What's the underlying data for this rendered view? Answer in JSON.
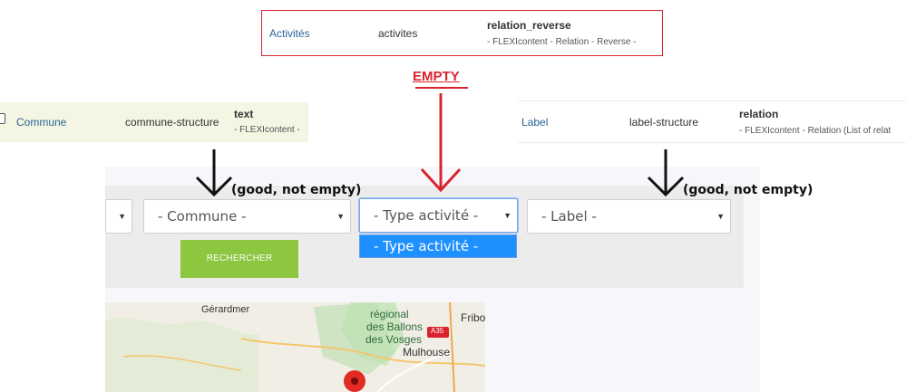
{
  "top_row": {
    "link": "Activités",
    "field_name": "activites",
    "type": "relation_reverse",
    "description": "- FLEXIcontent - Relation - Reverse -"
  },
  "annotation": {
    "empty": "EMPTY",
    "good_left": "(good, not empty)",
    "good_right": "(good, not empty)"
  },
  "left_row": {
    "link": "Commune",
    "field_name": "commune-structure",
    "type": "text",
    "description": "- FLEXIcontent -"
  },
  "right_row": {
    "link": "Label",
    "field_name": "label-structure",
    "type": "relation",
    "description": "- FLEXIcontent - Relation (List of relat"
  },
  "filters": {
    "commune": "- Commune -",
    "type_activite": "- Type activité -",
    "label": "- Label -",
    "dropdown_option": "- Type activité -",
    "search_button": "RECHERCHER"
  },
  "map": {
    "labels": [
      "Gérardmer",
      "régional",
      "des Ballons",
      "des Vosges",
      "Fribo",
      "A35",
      "Mulhouse"
    ]
  },
  "colors": {
    "annotation_red": "#d9232d",
    "link_blue": "#2a6496",
    "button_green": "#8dc63f",
    "dropdown_highlight": "#1e90ff"
  }
}
